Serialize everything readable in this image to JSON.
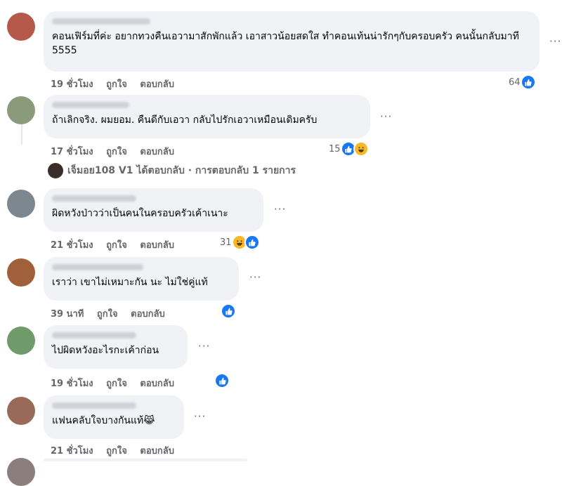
{
  "comments": [
    {
      "text": "คอนเฟิร์มที่ค่ะ อยากทวงคืนเอวามาสักพักแล้ว เอาสาวน้อยสดใส ทำคอนเท้นน่ารักๆกับครอบครัว คนนั้นกลับมาที 5555",
      "time": "19 ชั่วโมง",
      "reaction_count": "64",
      "avatar_color": "#b55a4a"
    },
    {
      "text": "ถ้าเลิกจริง. ผมยอม. คืนดีกับเอวา กลับไปรักเอวาเหมือนเดิมครับ",
      "time": "17 ชั่วโมง",
      "reaction_count": "15",
      "avatar_color": "#8a9a7b"
    },
    {
      "text": "ผิดหวังป่าวว่าเป็นคนในครอบครัวเค้าเนาะ",
      "time": "21 ชั่วโมง",
      "reaction_count": "31",
      "avatar_color": "#7d8790"
    },
    {
      "text": "เราว่า เขาไม่เหมาะกัน นะ ไม่ใช่คู่แท้",
      "time": "39 นาที",
      "reaction_count": "",
      "avatar_color": "#a0603a"
    },
    {
      "text": "ไปผิดหวังอะไรกะเค้าก่อน",
      "time": "19 ชั่วโมง",
      "reaction_count": "",
      "avatar_color": "#6f9a6a"
    },
    {
      "text": "แฟนคลับใจบางกันแท้😹",
      "time": "21 ชั่วโมง",
      "reaction_count": "",
      "avatar_color": "#9a6a58"
    }
  ],
  "labels": {
    "like": "ถูกใจ",
    "reply": "ตอบกลับ",
    "more": "···"
  },
  "reply_summary": "เจ็มอย108 V1 ได้ตอบกลับ · การตอบกลับ 1 รายการ",
  "colors": {
    "like_blue": "#1877f2",
    "haha_yellow": "#f7b928",
    "meta_gray": "#65676b"
  }
}
